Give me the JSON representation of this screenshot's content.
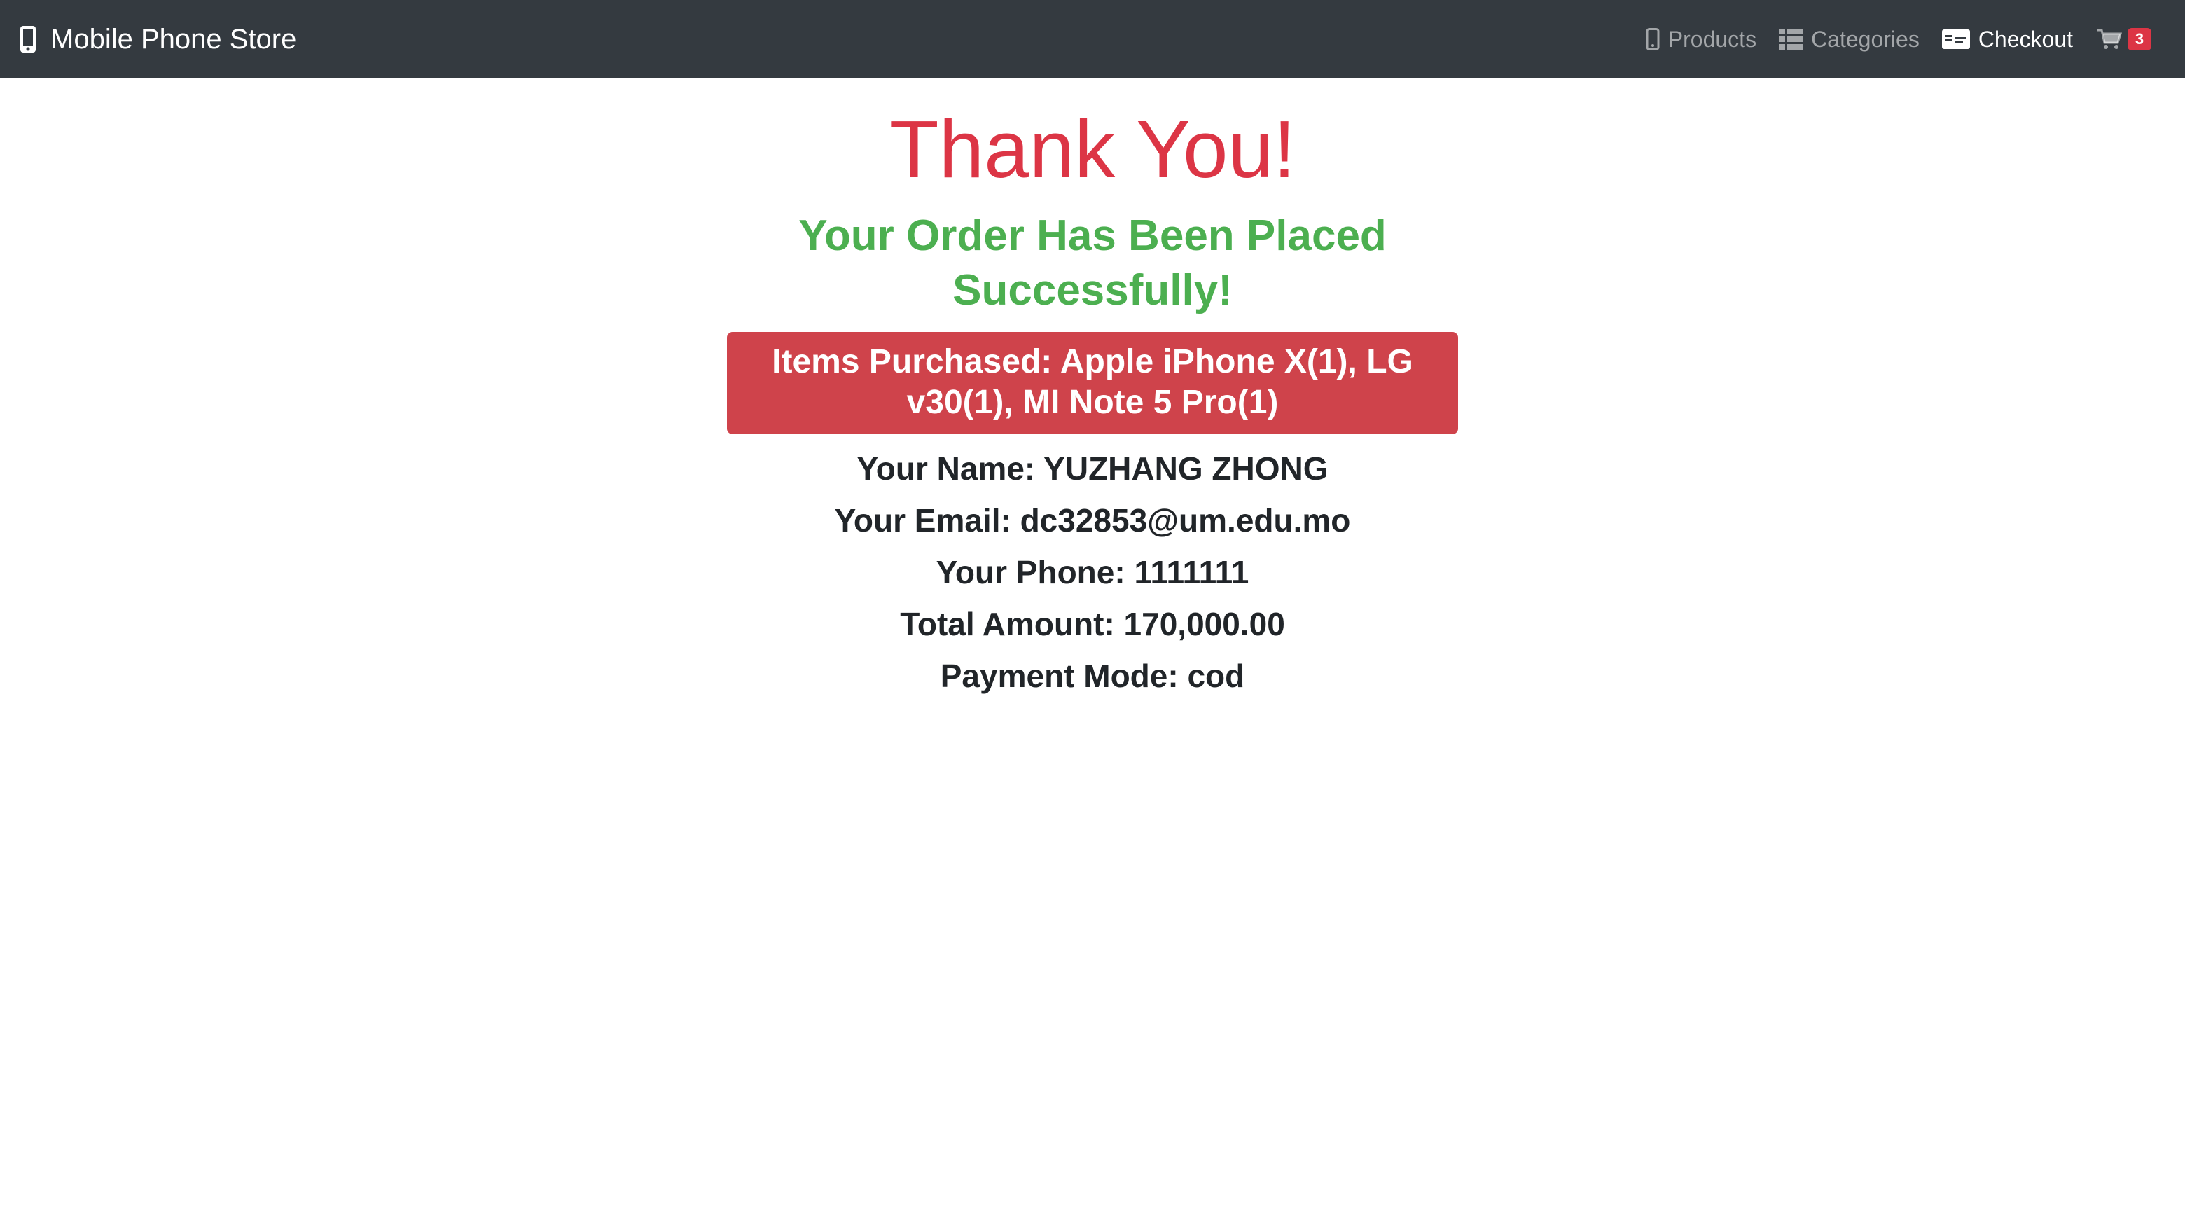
{
  "navbar": {
    "brand": "Mobile Phone Store",
    "links": [
      {
        "label": "Products",
        "icon": "mobile-icon"
      },
      {
        "label": "Categories",
        "icon": "list-icon"
      },
      {
        "label": "Checkout",
        "icon": "money-check-icon"
      }
    ],
    "cart_count": "3"
  },
  "main": {
    "heading": "Thank You!",
    "subheading": "Your Order Has Been Placed Successfully!",
    "items_purchased": "Items Purchased: Apple iPhone X(1), LG v30(1), MI Note 5 Pro(1)",
    "name_line": "Your Name: YUZHANG ZHONG",
    "email_line": "Your Email: dc32853@um.edu.mo",
    "phone_line": "Your Phone: 1111111",
    "total_line": "Total Amount: 170,000.00",
    "payment_line": "Payment Mode: cod"
  },
  "colors": {
    "navbar_bg": "#343a40",
    "heading": "#dc3545",
    "success": "#4caf50",
    "items_bg": "#cf434b"
  }
}
